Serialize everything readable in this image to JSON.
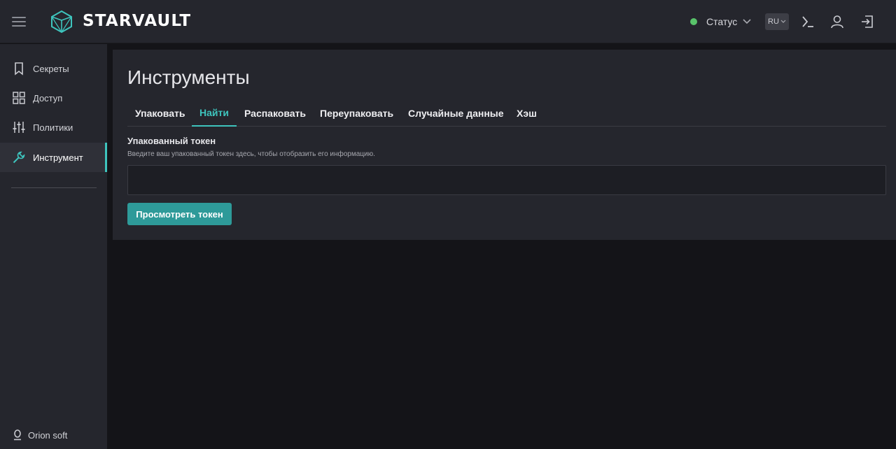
{
  "header": {
    "logo_text": "STARVAULT",
    "status_label": "Статус",
    "status_color": "#59c36a",
    "language": "RU",
    "icons": [
      "menu-icon",
      "logo-icon",
      "chevron-down-icon",
      "console-icon",
      "user-icon",
      "logout-icon"
    ]
  },
  "sidebar": {
    "items": [
      {
        "label": "Секреты",
        "icon": "bookmark-icon"
      },
      {
        "label": "Доступ",
        "icon": "grid-icon"
      },
      {
        "label": "Политики",
        "icon": "sliders-icon"
      },
      {
        "label": "Инструмент",
        "icon": "wrench-icon",
        "active": true
      }
    ],
    "footer_label": "Orion soft"
  },
  "main": {
    "title": "Инструменты",
    "tabs": [
      {
        "label": "Упаковать"
      },
      {
        "label": "Найти",
        "active": true
      },
      {
        "label": "Распаковать"
      },
      {
        "label": "Переупаковать"
      },
      {
        "label": "Случайные данные"
      },
      {
        "label": "Хэш"
      }
    ],
    "field_label": "Упакованный токен",
    "field_help": "Введите ваш упакованный токен здесь, чтобы отобразить его информацию.",
    "token_value": "",
    "submit_label": "Просмотреть токен"
  },
  "colors": {
    "accent": "#3ec4bd",
    "button": "#2e9a99",
    "header_bg": "#25262d",
    "page_bg": "#141418"
  }
}
